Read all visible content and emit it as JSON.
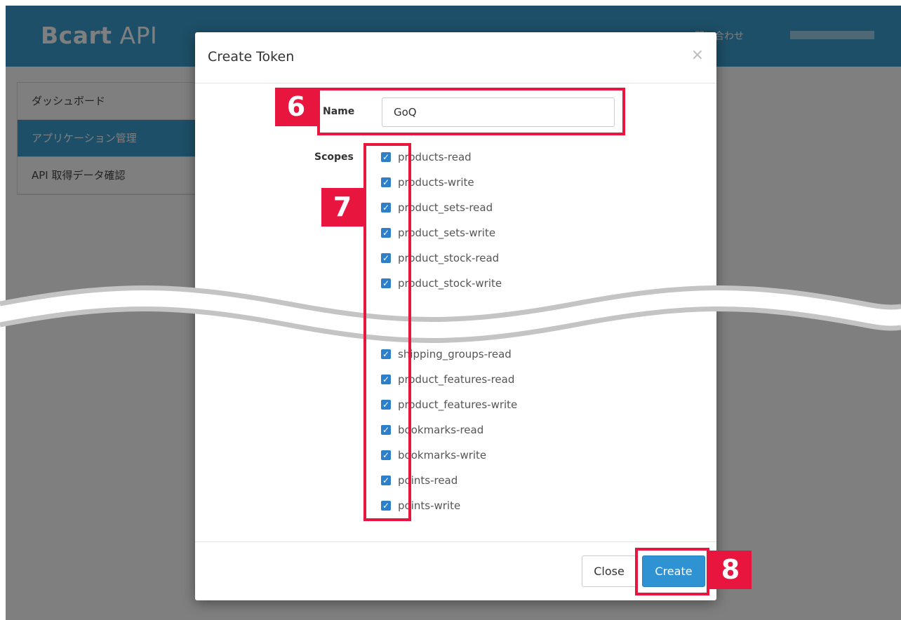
{
  "app": {
    "brand_bold": "Bcart",
    "brand_light": " API"
  },
  "nav": {
    "contact_label": "問い合わせ"
  },
  "sidebar": {
    "items": [
      {
        "label": "ダッシュボード"
      },
      {
        "label": "アプリケーション管理"
      },
      {
        "label": "API 取得データ確認"
      }
    ]
  },
  "modal": {
    "title": "Create Token",
    "close_glyph": "×",
    "name_label": "Name",
    "name_value": "GoQ",
    "scopes_label": "Scopes",
    "scopes_top": [
      "products-read",
      "products-write",
      "product_sets-read",
      "product_sets-write",
      "product_stock-read",
      "product_stock-write"
    ],
    "scopes_bottom": [
      "shipping_groups-read",
      "product_features-read",
      "product_features-write",
      "bookmarks-read",
      "bookmarks-write",
      "points-read",
      "points-write"
    ],
    "close_button": "Close",
    "create_button": "Create"
  },
  "annotations": {
    "step6": "6",
    "step7": "7",
    "step8": "8"
  },
  "colors": {
    "navbar": "#3b9fd0",
    "primary": "#2e92d3",
    "checkbox": "#2d7fc9",
    "annotation": "#e8153f"
  }
}
